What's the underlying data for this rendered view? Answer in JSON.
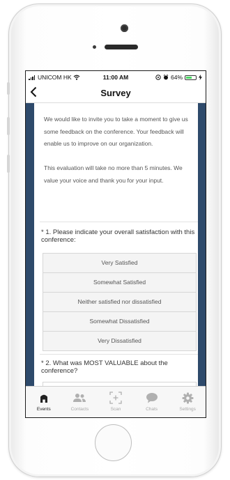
{
  "status_bar": {
    "carrier": "UNICOM HK",
    "time": "11:00 AM",
    "battery": "64%",
    "battery_level": 0.64
  },
  "nav": {
    "title": "Survey",
    "back_icon": "chevron-left-icon"
  },
  "survey": {
    "intro_paragraphs": [
      "We would like to invite you to take a moment to give us some feedback on the conference. Your feedback will enable us to improve on our organization.",
      "This evaluation will take no more than 5 minutes. We value your voice and thank you for your input."
    ],
    "questions": [
      {
        "text": "* 1. Please indicate your overall satisfaction with this conference:",
        "options": [
          "Very Satisfied",
          "Somewhat Satisfied",
          "Neither satisfied nor dissatisfied",
          "Somewhat Dissatisfied",
          "Very Dissatisfied"
        ]
      },
      {
        "text": "* 2. What was MOST VALUABLE about the conference?"
      }
    ]
  },
  "tabs": [
    {
      "label": "Events",
      "icon": "home-icon",
      "active": true
    },
    {
      "label": "Contacts",
      "icon": "contacts-icon",
      "active": false
    },
    {
      "label": "Scan",
      "icon": "scan-icon",
      "active": false
    },
    {
      "label": "Chats",
      "icon": "chat-icon",
      "active": false
    },
    {
      "label": "Settings",
      "icon": "gear-icon",
      "active": false
    }
  ],
  "colors": {
    "background_panel": "#2e4a6b",
    "battery_fill": "#4cd964",
    "tab_active": "#222222",
    "tab_inactive": "#a8a8a8"
  }
}
